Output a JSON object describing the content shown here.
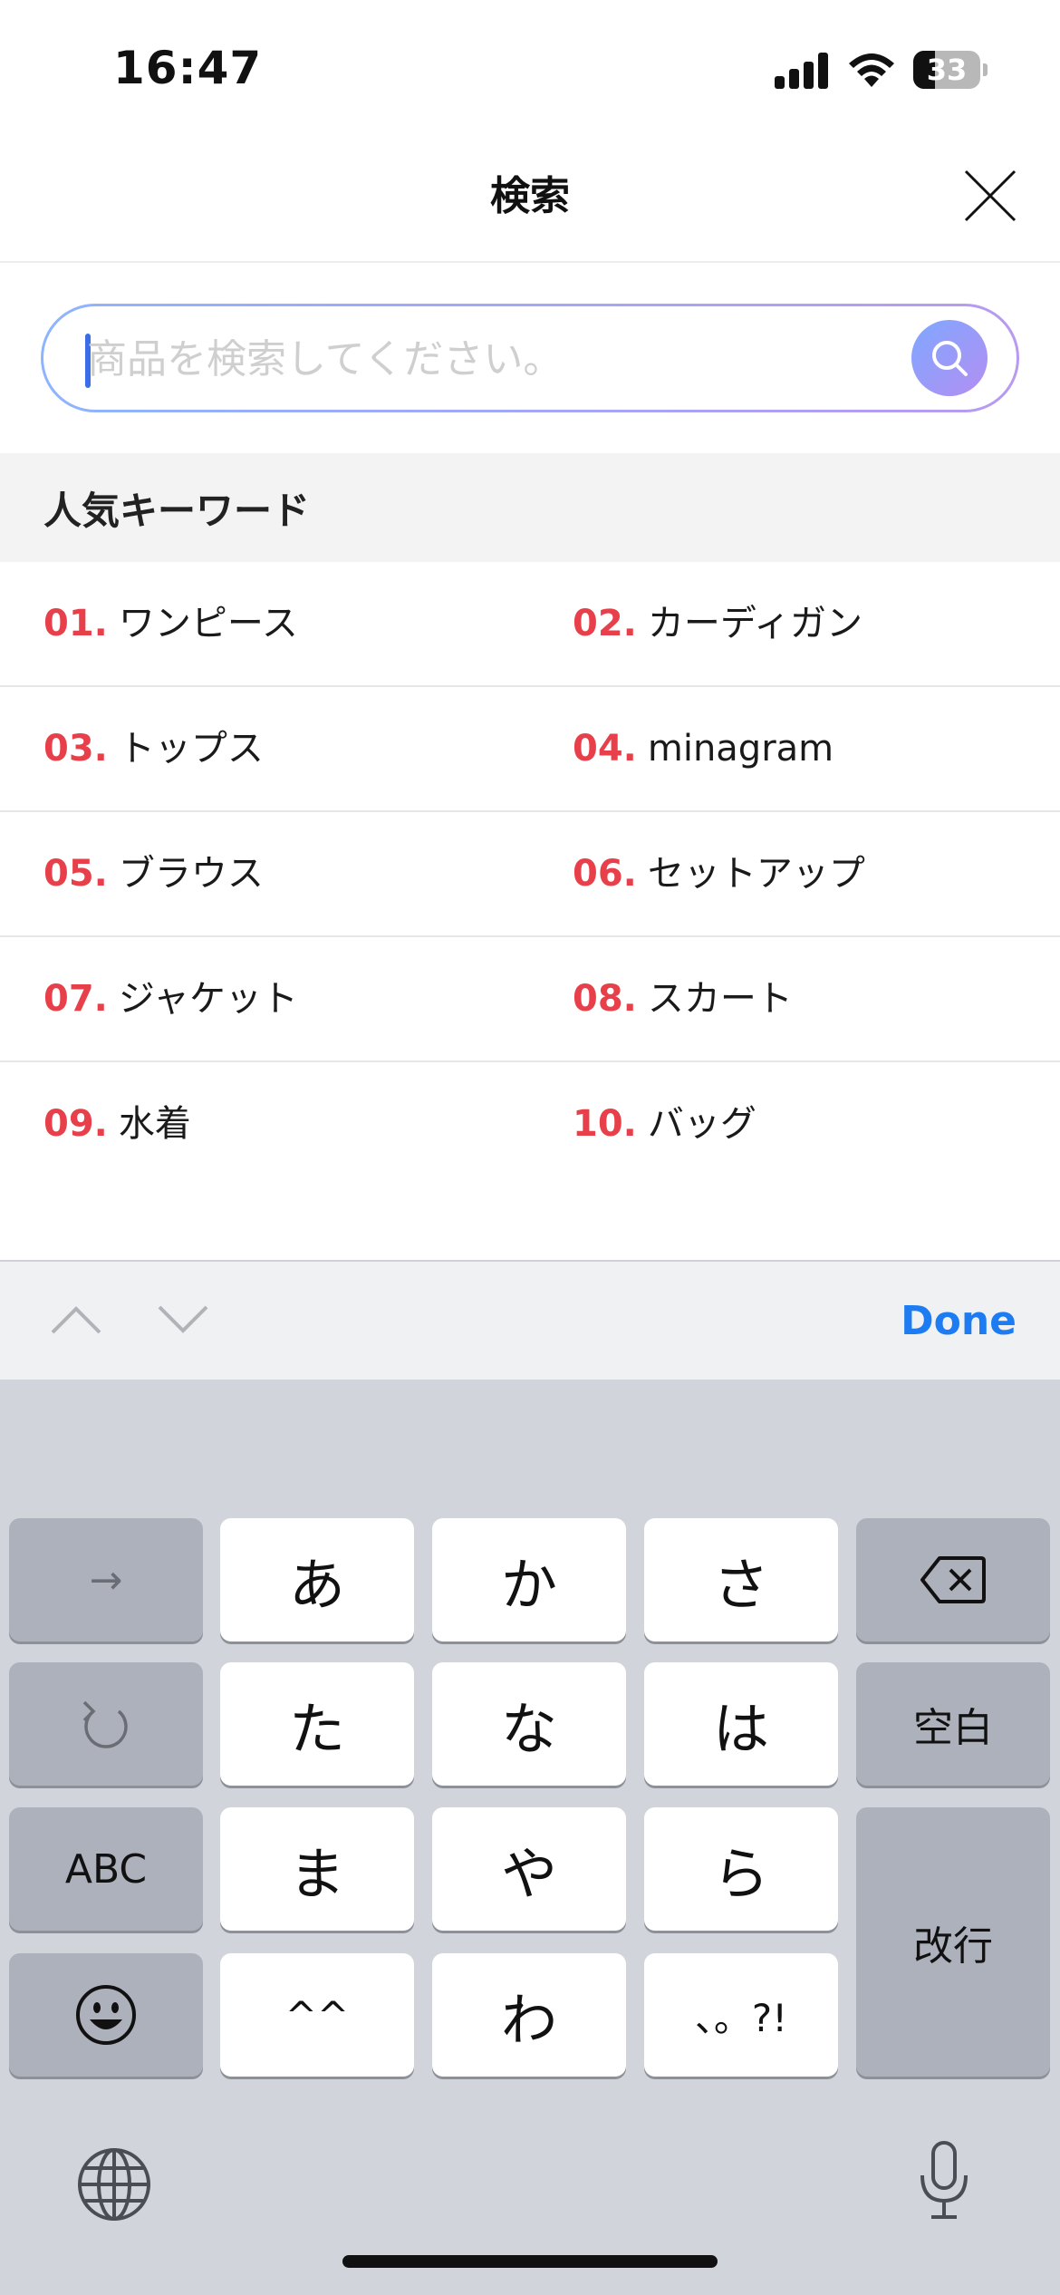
{
  "status": {
    "time": "16:47",
    "battery": "33",
    "battery_level": 0.33
  },
  "header": {
    "title": "検索"
  },
  "search": {
    "placeholder": "商品を検索してください。",
    "value": ""
  },
  "popular": {
    "title": "人気キーワード",
    "items": [
      {
        "num": "01.",
        "text": "ワンピース"
      },
      {
        "num": "02.",
        "text": "カーディガン"
      },
      {
        "num": "03.",
        "text": "トップス"
      },
      {
        "num": "04.",
        "text": "minagram"
      },
      {
        "num": "05.",
        "text": "ブラウス"
      },
      {
        "num": "06.",
        "text": "セットアップ"
      },
      {
        "num": "07.",
        "text": "ジャケット"
      },
      {
        "num": "08.",
        "text": "スカート"
      },
      {
        "num": "09.",
        "text": "水着"
      },
      {
        "num": "10.",
        "text": "バッグ"
      }
    ]
  },
  "accessory": {
    "done": "Done"
  },
  "keyboard": {
    "row1": [
      "→",
      "あ",
      "か",
      "さ"
    ],
    "row2": [
      "た",
      "な",
      "は",
      "空白"
    ],
    "row3": [
      "ABC",
      "ま",
      "や",
      "ら"
    ],
    "row4": [
      "^^",
      "わ",
      "、。?!",
      "改行"
    ]
  },
  "colors": {
    "accent": "#1d7cf2",
    "keyword_number": "#e8404b",
    "search_gradient_start": "#8fb4ff",
    "search_gradient_end": "#b89af0"
  }
}
